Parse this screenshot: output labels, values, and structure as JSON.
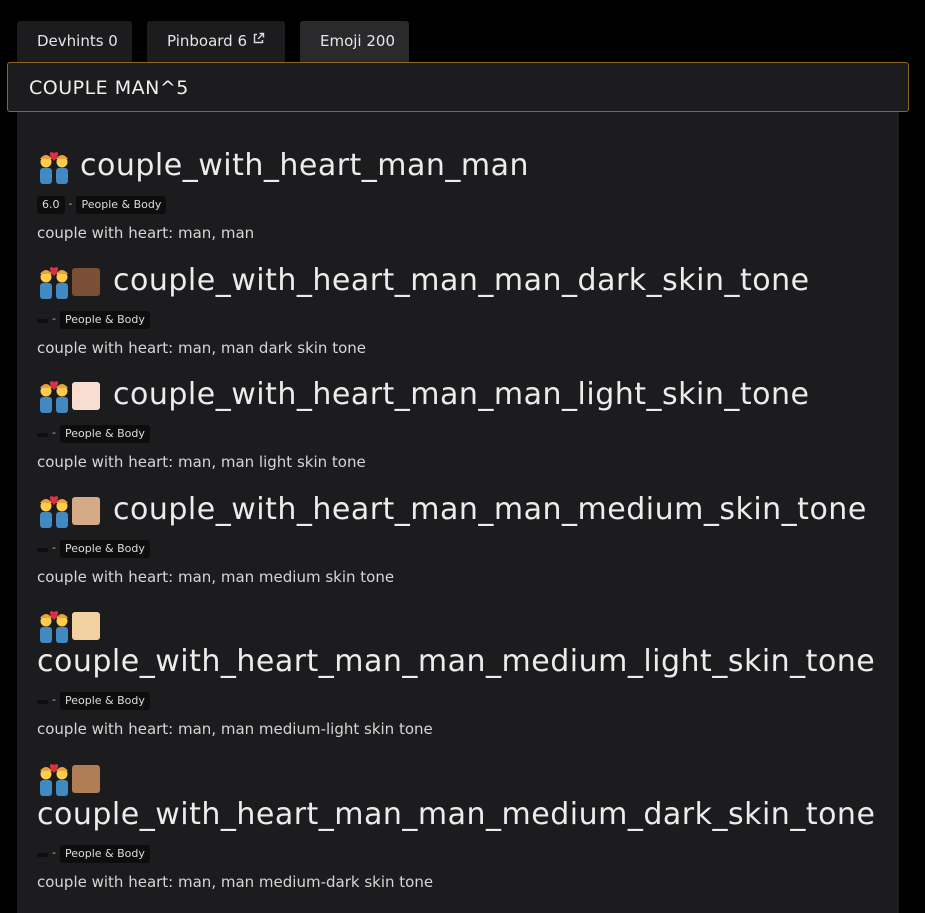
{
  "tabs": [
    {
      "label": "Devhints 0"
    },
    {
      "label": "Pinboard 6"
    },
    {
      "label": "Emoji 200"
    }
  ],
  "search": {
    "value": "COUPLE MAN^5"
  },
  "results": [
    {
      "name": "couple_with_heart_man_man",
      "version": "6.0",
      "category": "People & Body",
      "description": "couple with heart: man, man",
      "skin_tone_color": ""
    },
    {
      "name": "couple_with_heart_man_man_dark_skin_tone",
      "version": "",
      "category": "People & Body",
      "description": "couple with heart: man, man dark skin tone",
      "skin_tone_color": "#7b4e36"
    },
    {
      "name": "couple_with_heart_man_man_light_skin_tone",
      "version": "",
      "category": "People & Body",
      "description": "couple with heart: man, man light skin tone",
      "skin_tone_color": "#f7dece"
    },
    {
      "name": "couple_with_heart_man_man_medium_skin_tone",
      "version": "",
      "category": "People & Body",
      "description": "couple with heart: man, man medium skin tone",
      "skin_tone_color": "#d5aa87"
    },
    {
      "name": "couple_with_heart_man_man_medium_light_skin_tone",
      "version": "",
      "category": "People & Body",
      "description": "couple with heart: man, man medium-light skin tone",
      "skin_tone_color": "#f3d2a2"
    },
    {
      "name": "couple_with_heart_man_man_medium_dark_skin_tone",
      "version": "",
      "category": "People & Body",
      "description": "couple with heart: man, man medium-dark skin tone",
      "skin_tone_color": "#af7e57"
    }
  ],
  "colors": {
    "background": "#000000",
    "panel": "#1c1b1e",
    "search_border": "#8a6a1e",
    "badge_bg": "#0d0d0d"
  }
}
